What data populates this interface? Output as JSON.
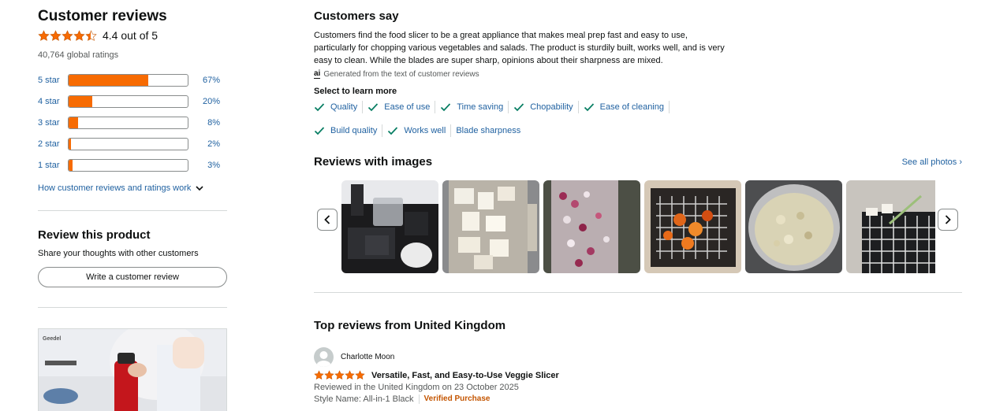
{
  "summary": {
    "title": "Customer reviews",
    "rating_value": 4.4,
    "rating_text": "4.4 out of 5",
    "global_ratings": "40,764 global ratings",
    "histogram": [
      {
        "label": "5 star",
        "percent": 67,
        "percent_text": "67%"
      },
      {
        "label": "4 star",
        "percent": 20,
        "percent_text": "20%"
      },
      {
        "label": "3 star",
        "percent": 8,
        "percent_text": "8%"
      },
      {
        "label": "2 star",
        "percent": 2,
        "percent_text": "2%"
      },
      {
        "label": "1 star",
        "percent": 3,
        "percent_text": "3%"
      }
    ],
    "how_link": "How customer reviews and ratings work"
  },
  "review_product": {
    "title": "Review this product",
    "subtitle": "Share your thoughts with other customers",
    "button": "Write a customer review"
  },
  "promo": {
    "brand": "Geedel"
  },
  "customers_say": {
    "title": "Customers say",
    "text": "Customers find the food slicer to be a great appliance that makes meal prep fast and easy to use, particularly for chopping various vegetables and salads. The product is sturdily built, works well, and is very easy to clean. While the blades are super sharp, opinions about their sharpness are mixed.",
    "ai_badge": "ai",
    "ai_note": "Generated from the text of customer reviews",
    "select_label": "Select to learn more",
    "aspects": [
      {
        "label": "Quality",
        "checked": true
      },
      {
        "label": "Ease of use",
        "checked": true
      },
      {
        "label": "Time saving",
        "checked": true
      },
      {
        "label": "Chopability",
        "checked": true
      },
      {
        "label": "Ease of cleaning",
        "checked": true
      },
      {
        "label": "Build quality",
        "checked": true
      },
      {
        "label": "Works well",
        "checked": true
      },
      {
        "label": "Blade sharpness",
        "checked": false
      }
    ]
  },
  "reviews_with_images": {
    "title": "Reviews with images",
    "see_all": "See all photos ›"
  },
  "top_reviews": {
    "title": "Top reviews from United Kingdom",
    "reviews": [
      {
        "author": "Charlotte Moon",
        "stars": 5,
        "title": "Versatile, Fast, and Easy-to-Use Veggie Slicer",
        "date": "Reviewed in the United Kingdom on 23 October 2025",
        "style": "Style Name: All-in-1 Black",
        "verified": "Verified Purchase"
      }
    ]
  },
  "colors": {
    "accent_orange": "#f76b02",
    "link_blue": "#2162a1",
    "check_green": "#067d62",
    "verified_orange": "#c45500"
  }
}
